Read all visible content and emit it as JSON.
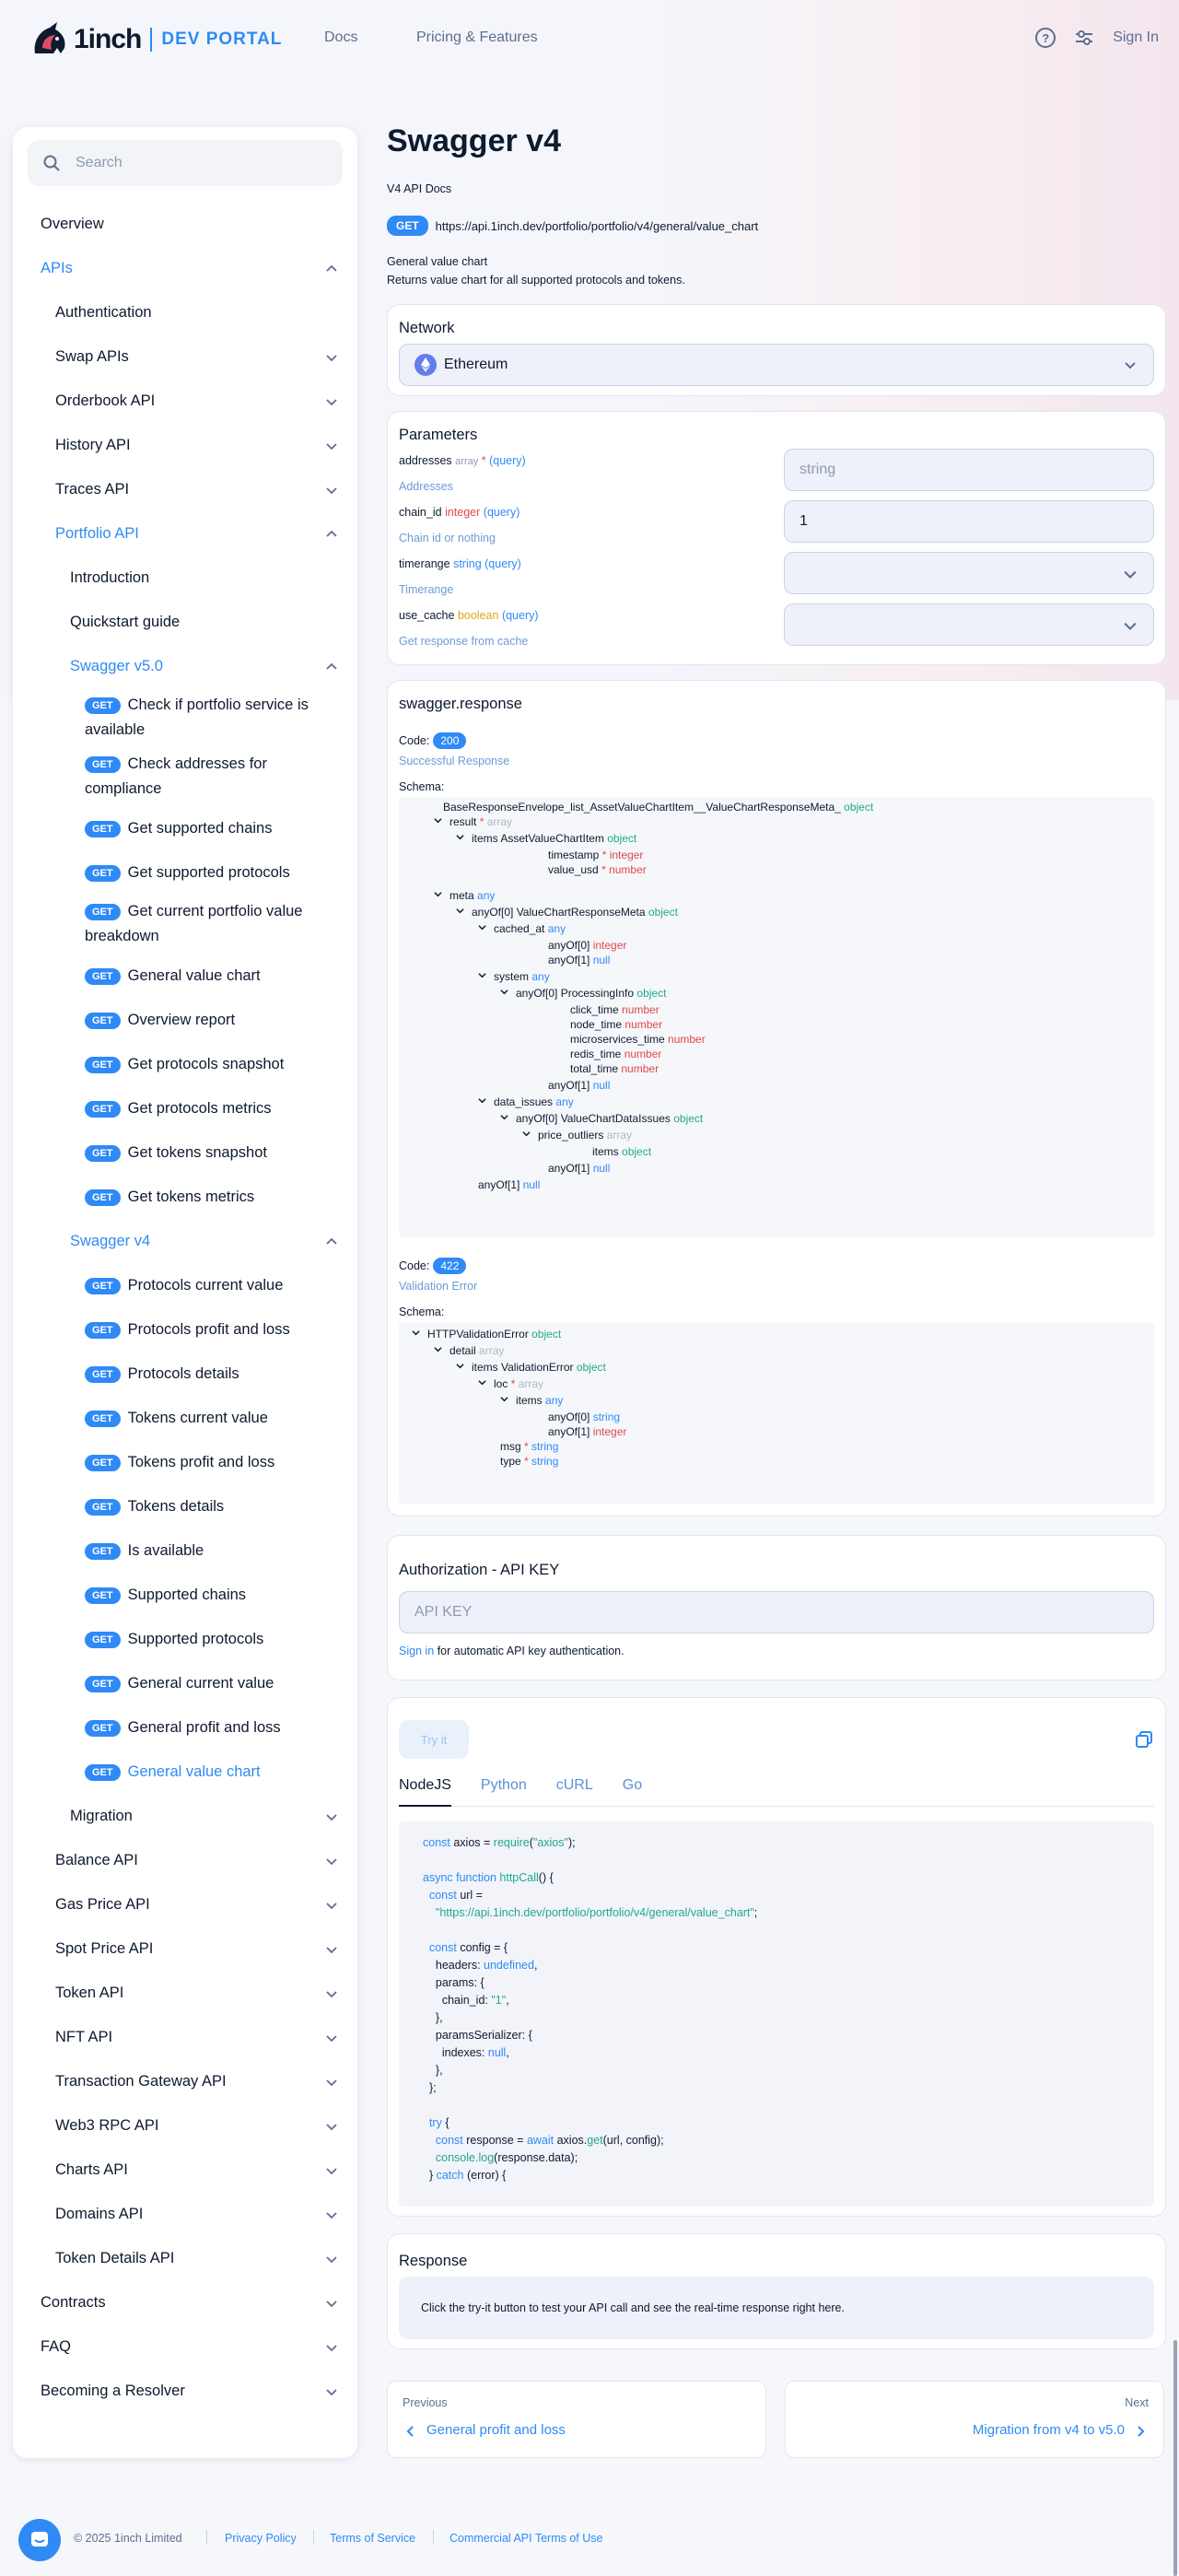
{
  "header": {
    "logo_text": "1inch",
    "logo_dev": "DEV PORTAL",
    "nav_docs": "Docs",
    "nav_pricing": "Pricing & Features",
    "sign_in": "Sign In",
    "help_icon": "?"
  },
  "sidebar": {
    "search_placeholder": "Search",
    "overview": "Overview",
    "apis": "APIs",
    "authentication": "Authentication",
    "swap_apis": "Swap APIs",
    "orderbook_api": "Orderbook API",
    "history_api": "History API",
    "traces_api": "Traces API",
    "portfolio_api": "Portfolio API",
    "introduction": "Introduction",
    "quickstart": "Quickstart guide",
    "swagger_v50": "Swagger v5.0",
    "get_badge": "GET",
    "v50_items": [
      "Check if portfolio service is available",
      "Check addresses for compliance",
      "Get supported chains",
      "Get supported protocols",
      "Get current portfolio value breakdown",
      "General value chart",
      "Overview report",
      "Get protocols snapshot",
      "Get protocols metrics",
      "Get tokens snapshot",
      "Get tokens metrics"
    ],
    "swagger_v4": "Swagger v4",
    "v4_items": [
      "Protocols current value",
      "Protocols profit and loss",
      "Protocols details",
      "Tokens current value",
      "Tokens profit and loss",
      "Tokens details",
      "Is available",
      "Supported chains",
      "Supported protocols",
      "General current value",
      "General profit and loss",
      "General value chart"
    ],
    "migration": "Migration",
    "lower_apis": [
      "Balance API",
      "Gas Price API",
      "Spot Price API",
      "Token API",
      "NFT API",
      "Transaction Gateway API",
      "Web3 RPC API",
      "Charts API",
      "Domains API",
      "Token Details API"
    ],
    "bottom": [
      "Contracts",
      "FAQ",
      "Becoming a Resolver"
    ]
  },
  "page": {
    "title": "Swagger v4",
    "subtitle": "V4 API Docs",
    "method": "GET",
    "url": "https://api.1inch.dev/portfolio/portfolio/v4/general/value_chart",
    "desc1": "General value chart",
    "desc2": "Returns value chart for all supported protocols and tokens."
  },
  "network": {
    "title": "Network",
    "value": "Ethereum"
  },
  "parameters": {
    "title": "Parameters",
    "items": [
      {
        "name": "addresses",
        "type": "array",
        "req": "*",
        "loc": "(query)",
        "label": "Addresses",
        "value": "string"
      },
      {
        "name": "chain_id",
        "type": "integer",
        "req": "",
        "loc": "(query)",
        "label": "Chain id or nothing",
        "value": "1"
      },
      {
        "name": "timerange",
        "type": "string",
        "req": "",
        "loc": "(query)",
        "label": "Timerange",
        "value": ""
      },
      {
        "name": "use_cache",
        "type": "boolean",
        "req": "",
        "loc": "(query)",
        "label": "Get response from cache",
        "value": ""
      }
    ]
  },
  "response_schema": {
    "title": "swagger.response",
    "code_label": "Code:",
    "schema_label": "Schema:",
    "code1": "200",
    "code1_desc": "Successful Response",
    "code2": "422",
    "code2_desc": "Validation Error",
    "s1": [
      {
        "t": "BaseResponseEnvelope_list_AssetValueChartItem__ValueChartResponseMeta_",
        "ty": "object",
        "c": "ty"
      },
      {
        "t": "result",
        "req": "*",
        "ty": "array",
        "c": "tg"
      },
      {
        "t": "items  AssetValueChartItem",
        "ty": "object",
        "c": "ty"
      },
      {
        "t": "timestamp",
        "req": "*",
        "ty": "integer",
        "c": "ti"
      },
      {
        "t": "value_usd",
        "req": "*",
        "ty": "number",
        "c": "ti"
      },
      {
        "t": "meta",
        "ty": "any",
        "c": "ta"
      },
      {
        "t": "anyOf[0]  ValueChartResponseMeta",
        "ty": "object",
        "c": "ty"
      },
      {
        "t": "cached_at",
        "ty": "any",
        "c": "ta"
      },
      {
        "t": "anyOf[0]",
        "ty": "integer",
        "c": "ti"
      },
      {
        "t": "anyOf[1]",
        "ty": "null",
        "c": "tn"
      },
      {
        "t": "system",
        "ty": "any",
        "c": "ta"
      },
      {
        "t": "anyOf[0]  ProcessingInfo",
        "ty": "object",
        "c": "ty"
      },
      {
        "t": "click_time",
        "ty": "number",
        "c": "ti"
      },
      {
        "t": "node_time",
        "ty": "number",
        "c": "ti"
      },
      {
        "t": "microservices_time",
        "ty": "number",
        "c": "ti"
      },
      {
        "t": "redis_time",
        "ty": "number",
        "c": "ti"
      },
      {
        "t": "total_time",
        "ty": "number",
        "c": "ti"
      },
      {
        "t": "anyOf[1]",
        "ty": "null",
        "c": "tn"
      },
      {
        "t": "data_issues",
        "ty": "any",
        "c": "ta"
      },
      {
        "t": "anyOf[0]  ValueChartDataIssues",
        "ty": "object",
        "c": "ty"
      },
      {
        "t": "price_outliers",
        "ty": "array",
        "c": "tg"
      },
      {
        "t": "items",
        "ty": "object",
        "c": "ty"
      },
      {
        "t": "anyOf[1]",
        "ty": "null",
        "c": "tn"
      },
      {
        "t": "anyOf[1]",
        "ty": "null",
        "c": "tn"
      }
    ],
    "s2": [
      {
        "t": "HTTPValidationError",
        "ty": "object",
        "c": "ty"
      },
      {
        "t": "detail",
        "ty": "array",
        "c": "tg"
      },
      {
        "t": "items  ValidationError",
        "ty": "object",
        "c": "ty"
      },
      {
        "t": "loc",
        "req": "*",
        "ty": "array",
        "c": "tg"
      },
      {
        "t": "items",
        "ty": "any",
        "c": "ta"
      },
      {
        "t": "anyOf[0]",
        "ty": "string",
        "c": "ts"
      },
      {
        "t": "anyOf[1]",
        "ty": "integer",
        "c": "ti"
      },
      {
        "t": "msg",
        "req": "*",
        "ty": "string",
        "c": "ts"
      },
      {
        "t": "type",
        "req": "*",
        "ty": "string",
        "c": "ts"
      }
    ]
  },
  "auth": {
    "title": "Authorization - API KEY",
    "placeholder": "API KEY",
    "sign_in": "Sign in",
    "note": " for automatic API key authentication."
  },
  "tryit": {
    "button": "Try it",
    "tabs": [
      "NodeJS",
      "Python",
      "cURL",
      "Go"
    ],
    "code": [
      [
        [
          "k",
          "const "
        ],
        [
          "",
          "axios = "
        ],
        [
          "f",
          "require"
        ],
        [
          "",
          "("
        ],
        [
          "s",
          "\"axios\""
        ],
        [
          "",
          ");"
        ]
      ],
      [],
      [
        [
          "k",
          "async function "
        ],
        [
          "f",
          "httpCall"
        ],
        [
          "",
          "() {"
        ]
      ],
      [
        [
          "",
          "  "
        ],
        [
          "k",
          "const "
        ],
        [
          "",
          "url ="
        ]
      ],
      [
        [
          "",
          "    "
        ],
        [
          "s",
          "\"https://api.1inch.dev/portfolio/portfolio/v4/general/value_chart\""
        ],
        [
          "",
          ";"
        ]
      ],
      [],
      [
        [
          "",
          "  "
        ],
        [
          "k",
          "const "
        ],
        [
          "",
          "config = {"
        ]
      ],
      [
        [
          "",
          "    headers: "
        ],
        [
          "k",
          "undefined"
        ],
        [
          "",
          ","
        ]
      ],
      [
        [
          "",
          "    params: {"
        ]
      ],
      [
        [
          "",
          "      chain_id: "
        ],
        [
          "s",
          "\"1\""
        ],
        [
          "",
          ","
        ]
      ],
      [
        [
          "",
          "    },"
        ]
      ],
      [
        [
          "",
          "    paramsSerializer: {"
        ]
      ],
      [
        [
          "",
          "      indexes: "
        ],
        [
          "k",
          "null"
        ],
        [
          "",
          ","
        ]
      ],
      [
        [
          "",
          "    },"
        ]
      ],
      [
        [
          "",
          "  };"
        ]
      ],
      [],
      [
        [
          "",
          "  "
        ],
        [
          "k",
          "try"
        ],
        [
          "",
          " {"
        ]
      ],
      [
        [
          "",
          "    "
        ],
        [
          "k",
          "const "
        ],
        [
          "",
          "response = "
        ],
        [
          "k",
          "await "
        ],
        [
          "",
          "axios."
        ],
        [
          "f",
          "get"
        ],
        [
          "",
          "(url, config);"
        ]
      ],
      [
        [
          "",
          "    "
        ],
        [
          "f",
          "console.log"
        ],
        [
          "",
          "(response.data);"
        ]
      ],
      [
        [
          "",
          "  } "
        ],
        [
          "k",
          "catch"
        ],
        [
          "",
          " (error) {"
        ]
      ]
    ]
  },
  "response": {
    "title": "Response",
    "note": "Click the try-it button to test your API call and see the real-time response right here."
  },
  "pager": {
    "prev_label": "Previous",
    "prev": "General profit and loss",
    "next_label": "Next",
    "next": "Migration from v4 to v5.0"
  },
  "footer": {
    "copyright": "© 2025 1inch Limited",
    "links": [
      "Privacy Policy",
      "Terms of Service",
      "Commercial API Terms of Use"
    ]
  }
}
